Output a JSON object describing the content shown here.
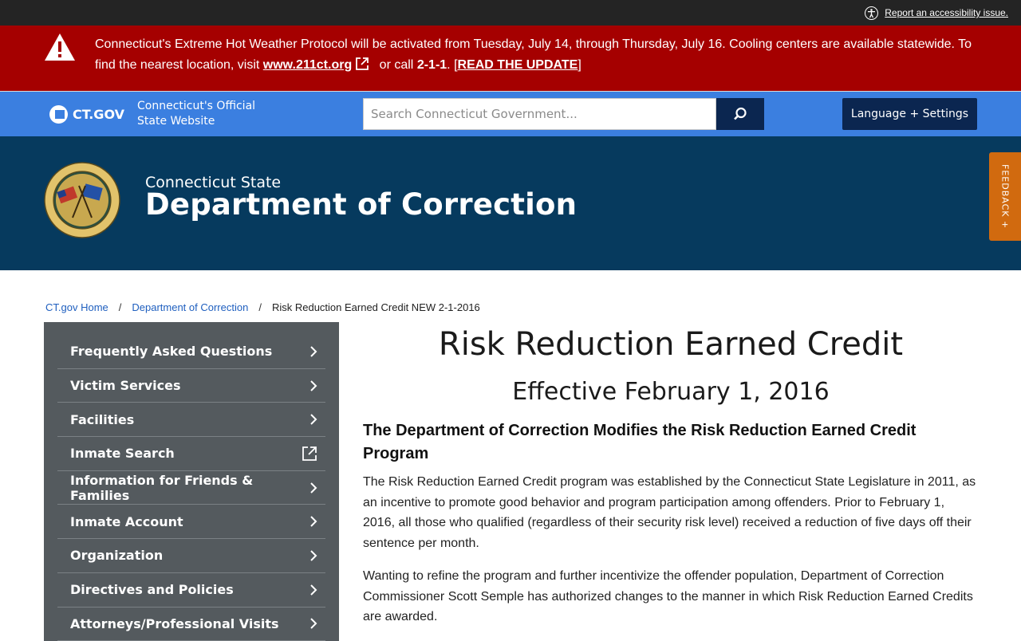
{
  "utility": {
    "accessibility_link": "Report an accessibility issue."
  },
  "alert": {
    "text_before": "Connecticut's Extreme Hot Weather Protocol will be activated from Tuesday, July 14, through Thursday, July 16. Cooling centers are available statewide. To find the nearest location, visit ",
    "link": "www.211ct.org",
    "text_mid": " or call ",
    "phone": "2-1-1",
    "text_after": ". [",
    "update_link": "READ THE UPDATE",
    "close_bracket": "]",
    "colors": {
      "background": "#a50000"
    }
  },
  "gov_bar": {
    "logo_text": "CT.GOV",
    "tagline_line1": "Connecticut's Official",
    "tagline_line2": "State Website",
    "search_placeholder": "Search Connecticut Government...",
    "language_button": "Language + Settings",
    "colors": {
      "background": "#3b7fe0",
      "buttons": "#0b2650"
    }
  },
  "agency": {
    "subtitle": "Connecticut State",
    "title": "Department of Correction",
    "seal_icon": "department-of-correction-seal",
    "feedback_tab": "FEEDBACK +",
    "colors": {
      "background": "#063a5e",
      "feedback": "#d16a0f"
    }
  },
  "breadcrumb": {
    "home": "CT.gov Home",
    "sep": "/",
    "parent": "Department of Correction",
    "current": "Risk Reduction Earned Credit NEW 2-1-2016"
  },
  "sidebar": {
    "items": [
      {
        "label": "Frequently Asked Questions",
        "icon": "chevron-right-icon"
      },
      {
        "label": "Victim Services",
        "icon": "chevron-right-icon"
      },
      {
        "label": "Facilities",
        "icon": "chevron-right-icon"
      },
      {
        "label": "Inmate Search",
        "icon": "external-link-icon"
      },
      {
        "label": "Information for Friends & Families",
        "icon": "chevron-right-icon"
      },
      {
        "label": "Inmate Account",
        "icon": "chevron-right-icon"
      },
      {
        "label": "Organization",
        "icon": "chevron-right-icon"
      },
      {
        "label": "Directives and Policies",
        "icon": "chevron-right-icon"
      },
      {
        "label": "Attorneys/Professional Visits",
        "icon": "chevron-right-icon"
      }
    ]
  },
  "main": {
    "title": "Risk Reduction Earned Credit",
    "subtitle": "Effective February 1, 2016",
    "heading": "The Department of Correction Modifies the Risk Reduction Earned Credit Program",
    "paragraphs": [
      "The Risk Reduction Earned Credit program was established by the Connecticut State Legislature in 2011, as an incentive to promote good behavior and program participation among offenders. Prior to February 1, 2016, all those who qualified (regardless of their security risk level) received a reduction of five days off their sentence per month.",
      "Wanting to refine the program and further incentivize the offender population, Department of Correction Commissioner Scott Semple has authorized changes to the manner in which Risk Reduction Earned Credits are awarded."
    ]
  }
}
